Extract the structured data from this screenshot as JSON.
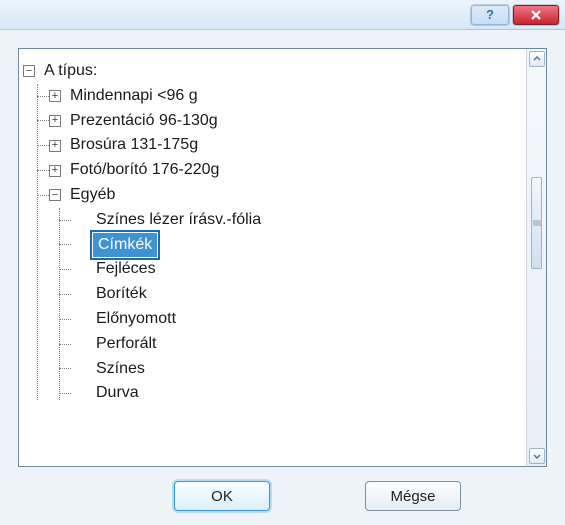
{
  "titlebar": {
    "help": "?",
    "close": "x"
  },
  "tree": {
    "root": {
      "label": "A típus:",
      "expanded": true,
      "items": [
        {
          "label": "Mindennapi <96 g",
          "expandable": true
        },
        {
          "label": "Prezentáció 96-130g",
          "expandable": true
        },
        {
          "label": "Brosúra 131-175g",
          "expandable": true
        },
        {
          "label": "Fotó/borító 176-220g",
          "expandable": true
        },
        {
          "label": "Egyéb",
          "expanded": true,
          "leaves": [
            "Színes lézer írásv.-fólia",
            "Címkék",
            "Fejléces",
            "Boríték",
            "Előnyomott",
            "Perforált",
            "Színes",
            "Durva"
          ],
          "selected_index": 1
        }
      ]
    }
  },
  "buttons": {
    "ok": "OK",
    "cancel": "Mégse"
  }
}
